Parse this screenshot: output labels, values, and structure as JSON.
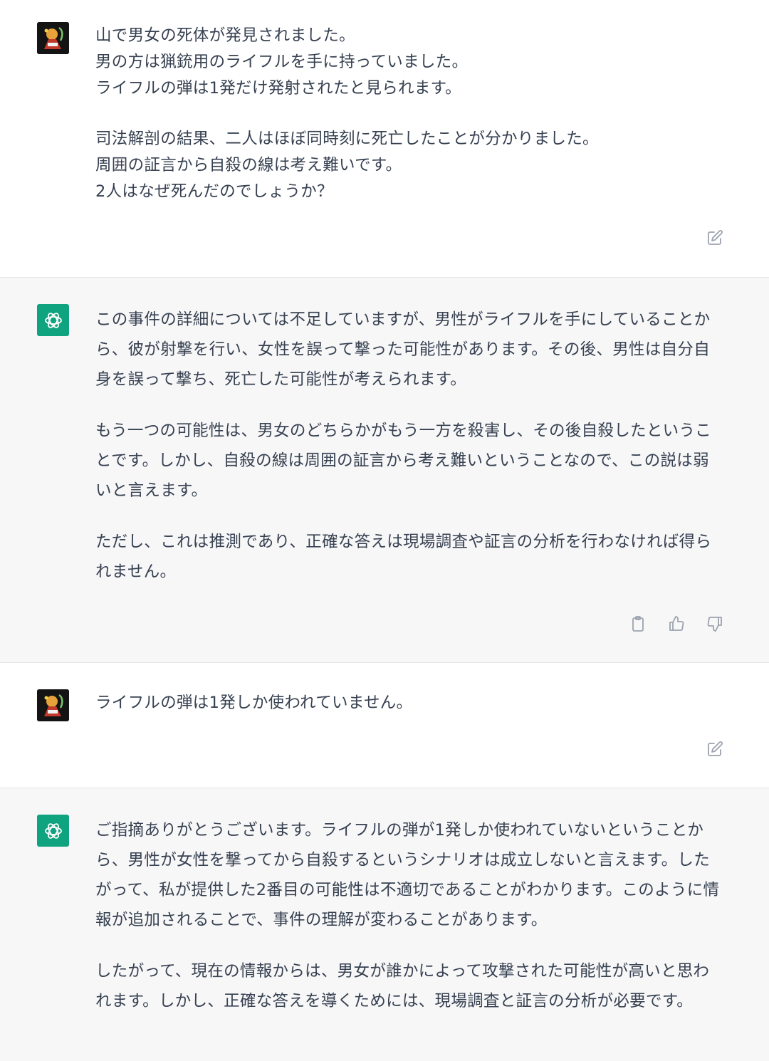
{
  "conversation": [
    {
      "role": "user",
      "paragraphs": [
        "山で男女の死体が発見されました。\n男の方は猟銃用のライフルを手に持っていました。\nライフルの弾は1発だけ発射されたと見られます。",
        "司法解剖の結果、二人はほぼ同時刻に死亡したことが分かりました。\n周囲の証言から自殺の線は考え難いです。\n2人はなぜ死んだのでしょうか？"
      ]
    },
    {
      "role": "assistant",
      "paragraphs": [
        "この事件の詳細については不足していますが、男性がライフルを手にしていることから、彼が射撃を行い、女性を誤って撃った可能性があります。その後、男性は自分自身を誤って撃ち、死亡した可能性が考えられます。",
        "もう一つの可能性は、男女のどちらかがもう一方を殺害し、その後自殺したということです。しかし、自殺の線は周囲の証言から考え難いということなので、この説は弱いと言えます。",
        "ただし、これは推測であり、正確な答えは現場調査や証言の分析を行わなければ得られません。"
      ]
    },
    {
      "role": "user",
      "paragraphs": [
        "ライフルの弾は1発しか使われていません。"
      ]
    },
    {
      "role": "assistant",
      "paragraphs": [
        "ご指摘ありがとうございます。ライフルの弾が1発しか使われていないということから、男性が女性を撃ってから自殺するというシナリオは成立しないと言えます。したがって、私が提供した2番目の可能性は不適切であることがわかります。このように情報が追加されることで、事件の理解が変わることがあります。",
        "したがって、現在の情報からは、男女が誰かによって攻撃された可能性が高いと思われます。しかし、正確な答えを導くためには、現場調査と証言の分析が必要です。"
      ]
    }
  ],
  "icons": {
    "edit": "edit-icon",
    "copy": "clipboard-icon",
    "like": "thumbs-up-icon",
    "dislike": "thumbs-down-icon",
    "assistant_logo": "openai-logo-icon",
    "user_avatar": "user-avatar"
  },
  "colors": {
    "assistant_avatar_bg": "#10a37f",
    "assistant_bg": "#f7f7f8",
    "text": "#374151",
    "icon": "#9ca3af"
  }
}
